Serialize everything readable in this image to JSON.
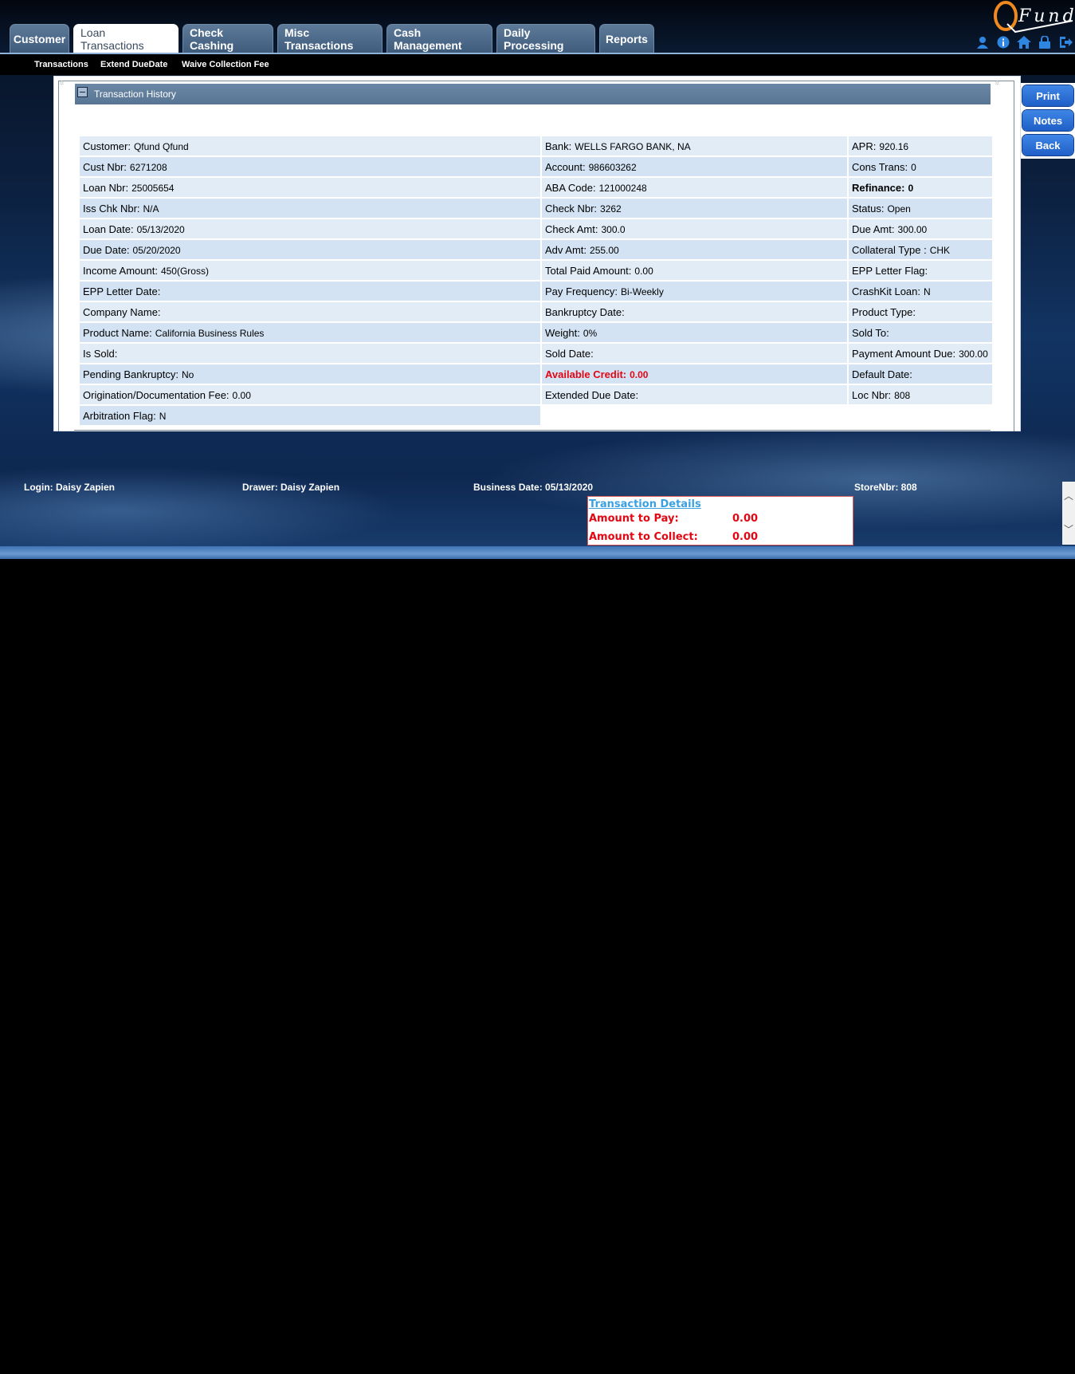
{
  "app": {
    "logo_text": "Fund"
  },
  "tabs": [
    {
      "label": "Customer",
      "active": false
    },
    {
      "label": "Loan Transactions",
      "active": true
    },
    {
      "label": "Check Cashing",
      "active": false
    },
    {
      "label": "Misc Transactions",
      "active": false
    },
    {
      "label": "Cash Management",
      "active": false
    },
    {
      "label": "Daily Processing",
      "active": false
    },
    {
      "label": "Reports",
      "active": false
    }
  ],
  "header_icons": [
    "user-icon",
    "info-icon",
    "home-icon",
    "lock-icon",
    "logout-icon"
  ],
  "subnav": [
    "Transactions",
    "Extend DueDate",
    "Waive Collection Fee"
  ],
  "section": {
    "title": "Transaction History"
  },
  "details": {
    "rows": [
      [
        {
          "label": "Customer:",
          "value": "Qfund Qfund"
        },
        {
          "label": "Bank:",
          "value": "WELLS FARGO BANK, NA"
        },
        {
          "label": "APR:",
          "value": "920.16"
        }
      ],
      [
        {
          "label": "Cust Nbr:",
          "value": "6271208"
        },
        {
          "label": "Account:",
          "value": "986603262"
        },
        {
          "label": "Cons Trans:",
          "value": "0"
        }
      ],
      [
        {
          "label": "Loan Nbr:",
          "value": "25005654"
        },
        {
          "label": "ABA Code:",
          "value": "121000248"
        },
        {
          "label": "Refinance:",
          "value": "0",
          "bold": true
        }
      ],
      [
        {
          "label": "Iss Chk Nbr:",
          "value": "N/A"
        },
        {
          "label": "Check Nbr:",
          "value": "3262"
        },
        {
          "label": "Status:",
          "value": "Open"
        }
      ],
      [
        {
          "label": "Loan Date:",
          "value": "05/13/2020"
        },
        {
          "label": "Check Amt:",
          "value": "300.0"
        },
        {
          "label": "Due Amt:",
          "value": "300.00"
        }
      ],
      [
        {
          "label": "Due Date:",
          "value": "05/20/2020"
        },
        {
          "label": "Adv Amt:",
          "value": "255.00"
        },
        {
          "label": "Collateral Type :",
          "value": "CHK"
        }
      ],
      [
        {
          "label": "Income Amount:",
          "value": "450(Gross)"
        },
        {
          "label": "Total Paid Amount:",
          "value": "0.00"
        },
        {
          "label": "EPP Letter Flag:",
          "value": ""
        }
      ],
      [
        {
          "label": "EPP Letter Date:",
          "value": ""
        },
        {
          "label": "Pay Frequency:",
          "value": "Bi-Weekly"
        },
        {
          "label": "CrashKit Loan:",
          "value": "N"
        }
      ],
      [
        {
          "label": "Company Name:",
          "value": ""
        },
        {
          "label": "Bankruptcy Date:",
          "value": ""
        },
        {
          "label": "Product Type:",
          "value": ""
        }
      ],
      [
        {
          "label": "Product Name:",
          "value": "California Business Rules"
        },
        {
          "label": "Weight:",
          "value": "0%"
        },
        {
          "label": "Sold To:",
          "value": ""
        }
      ],
      [
        {
          "label": "Is Sold:",
          "value": ""
        },
        {
          "label": "Sold Date:",
          "value": ""
        },
        {
          "label": "Payment Amount Due:",
          "value": "300.00"
        }
      ],
      [
        {
          "label": "Pending Bankruptcy:",
          "value": "No"
        },
        {
          "label": "Available Credit:",
          "value": "0.00",
          "red": true
        },
        {
          "label": "Default Date:",
          "value": ""
        }
      ],
      [
        {
          "label": "Origination/Documentation Fee:",
          "value": "0.00"
        },
        {
          "label": "Extended Due Date:",
          "value": ""
        },
        {
          "label": "Loc Nbr:",
          "value": "808"
        }
      ],
      [
        {
          "label": "Arbitration Flag:",
          "value": "N"
        }
      ]
    ]
  },
  "side_buttons": [
    "Print",
    "Notes",
    "Back"
  ],
  "footer": {
    "login": "Login: Daisy Zapien",
    "drawer": "Drawer: Daisy Zapien",
    "business_date": "Business Date: 05/13/2020",
    "store": "StoreNbr: 808"
  },
  "transaction_details": {
    "link": "Transaction Details",
    "amount_to_pay_label": "Amount to Pay:",
    "amount_to_pay": "0.00",
    "amount_to_collect_label": "Amount to Collect:",
    "amount_to_collect": "0.00"
  },
  "colors": {
    "accent": "#1f5fc8",
    "alert": "#e30613",
    "tab": "#4a6786"
  }
}
